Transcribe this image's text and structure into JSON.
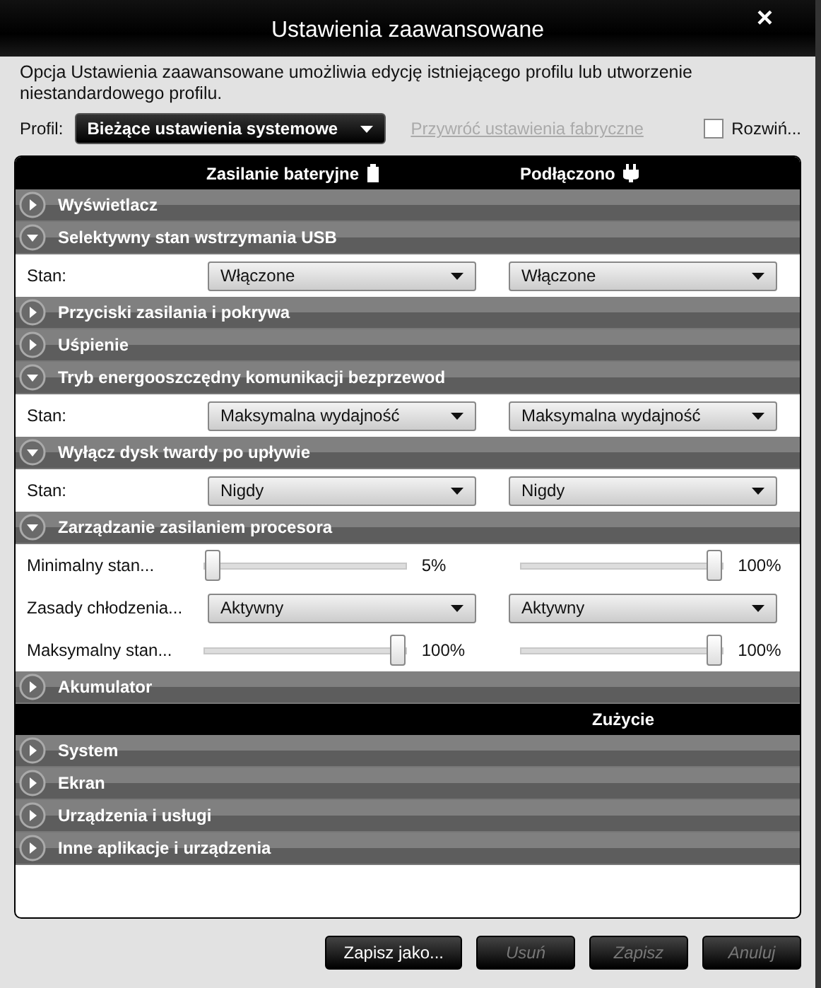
{
  "window": {
    "title": "Ustawienia zaawansowane",
    "close": "×"
  },
  "description": "Opcja Ustawienia zaawansowane umożliwia edycję istniejącego profilu lub utworzenie niestandardowego profilu.",
  "profile": {
    "label": "Profil:",
    "value": "Bieżące ustawienia systemowe",
    "restore_link": "Przywróć ustawienia fabryczne",
    "restore_disabled": true,
    "expand_label": "Rozwiń...",
    "expand_checked": false
  },
  "columns": {
    "battery": "Zasilanie bateryjne",
    "plugged": "Podłączono"
  },
  "sections": [
    {
      "title": "Wyświetlacz",
      "expanded": false
    },
    {
      "title": "Selektywny stan wstrzymania USB",
      "expanded": true,
      "rows": [
        {
          "kind": "dropdown",
          "label": "Stan:",
          "battery": "Włączone",
          "plugged": "Włączone"
        }
      ]
    },
    {
      "title": "Przyciski zasilania i pokrywa",
      "expanded": false
    },
    {
      "title": "Uśpienie",
      "expanded": false
    },
    {
      "title": "Tryb energooszczędny komunikacji bezprzewod",
      "expanded": true,
      "rows": [
        {
          "kind": "dropdown",
          "label": "Stan:",
          "battery": "Maksymalna wydajność",
          "plugged": "Maksymalna wydajność"
        }
      ]
    },
    {
      "title": "Wyłącz dysk twardy po upływie",
      "expanded": true,
      "rows": [
        {
          "kind": "dropdown",
          "label": "Stan:",
          "battery": "Nigdy",
          "plugged": "Nigdy"
        }
      ]
    },
    {
      "title": "Zarządzanie zasilaniem procesora",
      "expanded": true,
      "rows": [
        {
          "kind": "slider",
          "label": "Minimalny stan...",
          "battery": {
            "level": 0.0,
            "reading": "5%"
          },
          "plugged": {
            "level": 1.0,
            "reading": "100%"
          }
        },
        {
          "kind": "dropdown",
          "label": "Zasady chłodzenia...",
          "battery": "Aktywny",
          "plugged": "Aktywny"
        },
        {
          "kind": "slider",
          "label": "Maksymalny stan...",
          "battery": {
            "level": 1.0,
            "reading": "100%"
          },
          "plugged": {
            "level": 1.0,
            "reading": "100%"
          }
        }
      ]
    },
    {
      "title": "Akumulator",
      "expanded": false
    }
  ],
  "usage_heading": "Zużycie",
  "usage_sections": [
    {
      "title": "System",
      "expanded": false
    },
    {
      "title": "Ekran",
      "expanded": false
    },
    {
      "title": "Urządzenia i usługi",
      "expanded": false
    },
    {
      "title": "Inne aplikacje i urządzenia",
      "expanded": false
    }
  ],
  "buttons": [
    {
      "label": "Zapisz jako...",
      "disabled": false
    },
    {
      "label": "Usuń",
      "disabled": true
    },
    {
      "label": "Zapisz",
      "disabled": true
    },
    {
      "label": "Anuluj",
      "disabled": true
    }
  ]
}
